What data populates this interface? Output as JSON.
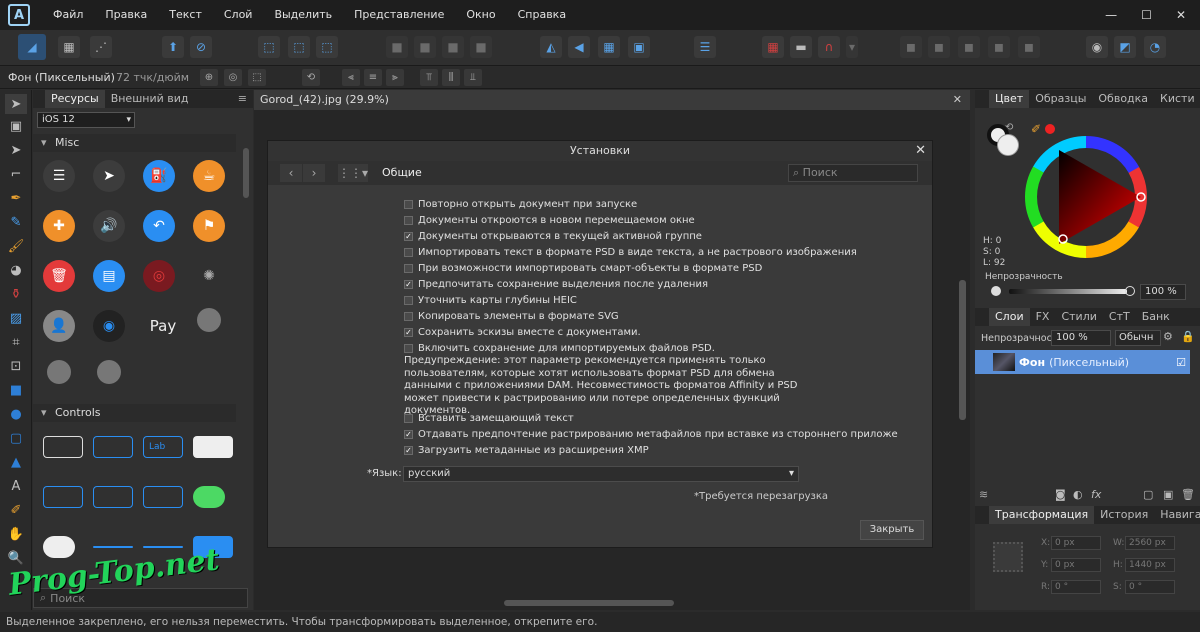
{
  "menu": [
    "Файл",
    "Правка",
    "Текст",
    "Слой",
    "Выделить",
    "Представление",
    "Окно",
    "Справка"
  ],
  "window_buttons": [
    "—",
    "☐",
    "✕"
  ],
  "context": {
    "layer_name": "Фон (Пиксельный)",
    "dpi": "72 тчк/дюйм"
  },
  "left_panel": {
    "tabs": [
      "Ресурсы",
      "Внешний вид"
    ],
    "category": "iOS 12",
    "sections": [
      "Misc",
      "Controls"
    ],
    "search_placeholder": "Поиск"
  },
  "document": {
    "tab_title": "Gorod_(42).jpg (29.9%)"
  },
  "dialog": {
    "title": "Установки",
    "section": "Общие",
    "search_placeholder": "Поиск",
    "options": [
      {
        "label": "Повторно открыть документ при запуске",
        "checked": false
      },
      {
        "label": "Документы откроются в новом перемещаемом окне",
        "checked": false
      },
      {
        "label": "Документы открываются в текущей активной группе",
        "checked": true
      },
      {
        "label": "Импортировать текст в формате PSD в виде текста, а не растрового изображения",
        "checked": false
      },
      {
        "label": "При возможности импортировать смарт-объекты в формате PSD",
        "checked": false
      },
      {
        "label": "Предпочитать сохранение выделения после удаления",
        "checked": true
      },
      {
        "label": "Уточнить карты глубины HEIC",
        "checked": false
      },
      {
        "label": "Копировать элементы в формате SVG",
        "checked": false
      },
      {
        "label": "Сохранить эскизы вместе с документами.",
        "checked": true
      },
      {
        "label": "Включить сохранение для импортируемых файлов PSD.",
        "checked": false
      }
    ],
    "warning": "Предупреждение: этот параметр рекомендуется применять только пользователям, которые хотят использовать формат PSD для обмена данными с приложениями DAM. Несовместимость форматов Affinity и PSD может привести к растрированию или потере определенных функций документов.",
    "options2": [
      {
        "label": "Вставить замещающий текст",
        "checked": false
      },
      {
        "label": "Отдавать предпочтение растрированию метафайлов при вставке из стороннего приложе",
        "checked": true
      },
      {
        "label": "Загрузить метаданные из расширения XMP",
        "checked": true
      }
    ],
    "language_label": "*Язык:",
    "language_value": "русский",
    "restart_note": "*Требуется перезагрузка",
    "close_label": "Закрыть"
  },
  "right_panel": {
    "top_tabs": [
      "Цвет",
      "Образцы",
      "Обводка",
      "Кисти"
    ],
    "hsl": [
      "H: 0",
      "S: 0",
      "L: 92"
    ],
    "opacity_label": "Непрозрачность",
    "opacity_value": "100 %",
    "layer_tabs": [
      "Слои",
      "FX",
      "Стили",
      "СтТ",
      "Банк"
    ],
    "layer_opacity_label": "Непрозрачность:",
    "layer_opacity_value": "100 %",
    "blend_mode": "Обычн",
    "layer_name": "Фон",
    "layer_type": "(Пиксельный)",
    "bottom_tabs": [
      "Трансформация",
      "История",
      "Навигатор"
    ],
    "transform": {
      "x": "0 px",
      "y": "0 px",
      "w": "2560 px",
      "h": "1440 px",
      "r": "0 °",
      "s": "0 °"
    },
    "transform_labels": {
      "x": "X:",
      "y": "Y:",
      "w": "W:",
      "h": "H:",
      "r": "R:",
      "s": "S:"
    }
  },
  "status": "Выделенное закреплено, его нельзя переместить. Чтобы трансформировать выделенное, открепите его.",
  "watermark": "Prog-Top.net"
}
